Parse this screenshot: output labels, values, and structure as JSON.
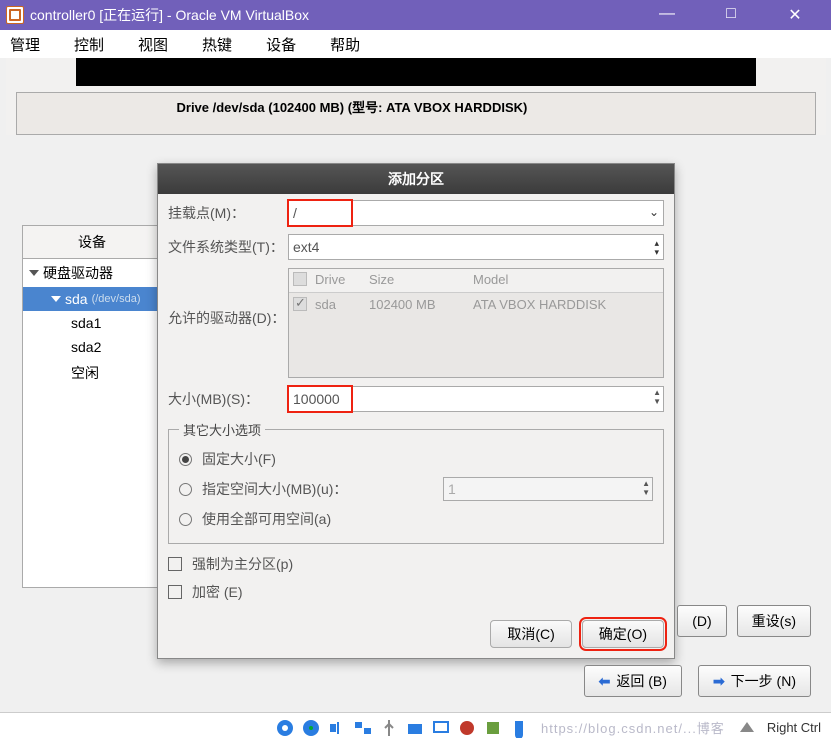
{
  "vbox": {
    "title": "controller0 [正在运行] - Oracle VM VirtualBox",
    "win_min": "—",
    "win_max": "□",
    "win_close": "✕"
  },
  "menu": {
    "manage": "管理",
    "control": "控制",
    "view": "视图",
    "hotkeys": "热键",
    "devices": "设备",
    "help": "帮助"
  },
  "drive_header": "Drive /dev/sda (102400 MB) (型号: ATA VBOX HARDDISK)",
  "tree": {
    "device_header": "设备",
    "hdd": "硬盘驱动器",
    "sda": "sda",
    "sda_path": "(/dev/sda)",
    "sda1": "sda1",
    "sda2": "sda2",
    "free": "空闲"
  },
  "dialog": {
    "title": "添加分区",
    "mount_label": "挂载点(M)：",
    "mount_value": "/",
    "fstype_label": "文件系统类型(T)：",
    "fstype_value": "ext4",
    "allowed_drives_label": "允许的驱动器(D)：",
    "table": {
      "h_drive": "Drive",
      "h_size": "Size",
      "h_model": "Model",
      "r_drive": "sda",
      "r_size": "102400 MB",
      "r_model": "ATA VBOX HARDDISK"
    },
    "size_label": "大小(MB)(S)：",
    "size_value": "100000",
    "other_legend": "其它大小选项",
    "opt_fixed": "固定大小(F)",
    "opt_spec": "指定空间大小(MB)(u)：",
    "opt_spec_value": "1",
    "opt_all": "使用全部可用空间(a)",
    "force_primary": "强制为主分区(p)",
    "encrypt": "加密 (E)",
    "cancel": "取消(C)",
    "ok": "确定(O)"
  },
  "wizard": {
    "d_btn": "(D)",
    "reset": "重设(s)",
    "back": "返回 (B)",
    "next": "下一步 (N)"
  },
  "status": {
    "watermark": "https://blog.csdn.net/...博客",
    "rctrl": "Right Ctrl"
  }
}
